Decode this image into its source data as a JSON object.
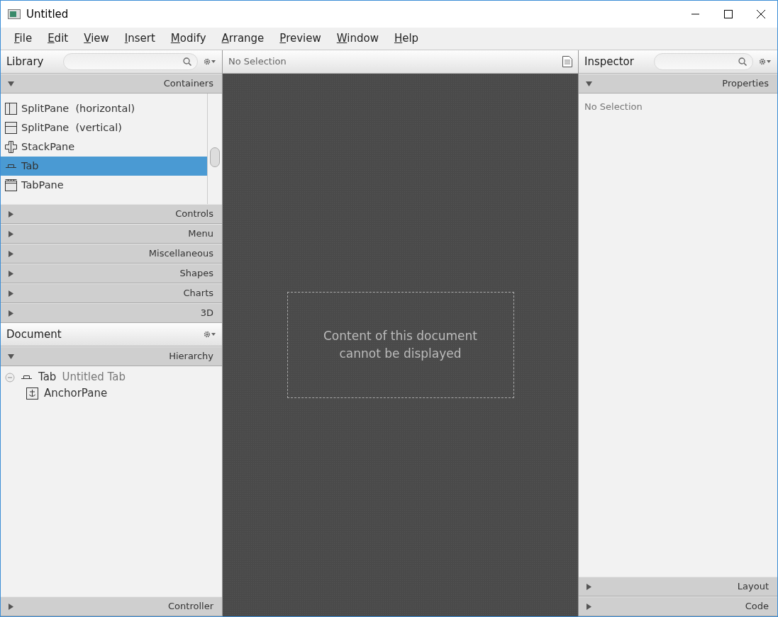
{
  "window": {
    "title": "Untitled"
  },
  "menu": [
    "File",
    "Edit",
    "View",
    "Insert",
    "Modify",
    "Arrange",
    "Preview",
    "Window",
    "Help"
  ],
  "library": {
    "title": "Library",
    "sections": [
      {
        "label": "Containers",
        "expanded": true,
        "items": [
          {
            "kind": "splitpane-horizontal",
            "label": "SplitPane  (horizontal)",
            "selected": false
          },
          {
            "kind": "splitpane-vertical",
            "label": "SplitPane  (vertical)",
            "selected": false
          },
          {
            "kind": "stackpane",
            "label": "StackPane",
            "selected": false
          },
          {
            "kind": "tab",
            "label": "Tab",
            "selected": true
          },
          {
            "kind": "tabpane",
            "label": "TabPane",
            "selected": false
          }
        ]
      },
      {
        "label": "Controls",
        "expanded": false
      },
      {
        "label": "Menu",
        "expanded": false
      },
      {
        "label": "Miscellaneous",
        "expanded": false
      },
      {
        "label": "Shapes",
        "expanded": false
      },
      {
        "label": "Charts",
        "expanded": false
      },
      {
        "label": "3D",
        "expanded": false
      }
    ]
  },
  "document": {
    "title": "Document",
    "sections": [
      {
        "label": "Hierarchy",
        "expanded": true,
        "tree": [
          {
            "kind": "tab",
            "type": "Tab",
            "label": "Untitled Tab",
            "expanded": true,
            "children": [
              {
                "kind": "anchorpane",
                "type": "AnchorPane"
              }
            ]
          }
        ]
      },
      {
        "label": "Controller",
        "expanded": false
      }
    ]
  },
  "content": {
    "title": "No Selection",
    "message": "Content of this document cannot be displayed"
  },
  "inspector": {
    "title": "Inspector",
    "sections": [
      {
        "label": "Properties",
        "expanded": true,
        "text": "No Selection"
      },
      {
        "label": "Layout",
        "expanded": false
      },
      {
        "label": "Code",
        "expanded": false
      }
    ]
  }
}
